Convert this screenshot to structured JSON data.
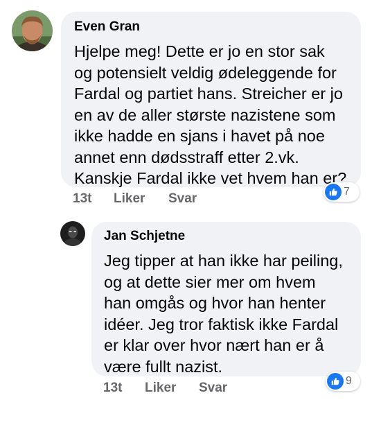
{
  "comments": [
    {
      "author": "Even Gran",
      "lines": [
        "Hjelpe meg! Dette er jo en stor sak",
        "og potensielt veldig ødeleggende for",
        "Fardal og partiet hans. Streicher er jo",
        "en av de aller største nazistene som",
        "ikke hadde en sjans i havet på noe",
        "annet enn dødsstraff etter 2.vk.",
        "Kanskje Fardal ikke vet hvem han er?"
      ],
      "time": "13t",
      "like_label": "Liker",
      "reply_label": "Svar",
      "reaction_count": "7"
    },
    {
      "author": "Jan Schjetne",
      "lines": [
        "Jeg tipper at han ikke har peiling,",
        "og at dette sier mer om hvem",
        "han omgås og hvor han henter",
        "idéer. Jeg tror faktisk ikke Fardal",
        "er klar over hvor nært han er å",
        "være fullt nazist."
      ],
      "time": "13t",
      "like_label": "Liker",
      "reply_label": "Svar",
      "reaction_count": "9"
    }
  ],
  "reaction_icon": "thumbs-up-icon",
  "colors": {
    "bubble_bg": "#f0f2f5",
    "meta_text": "#65676b",
    "like_blue": "#1877f2"
  }
}
